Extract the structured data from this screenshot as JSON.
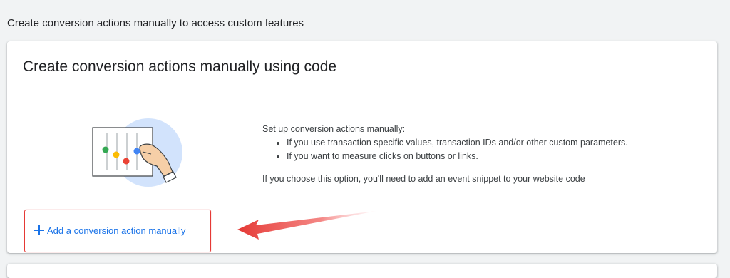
{
  "section": {
    "heading": "Create conversion actions manually to access custom features"
  },
  "card": {
    "title": "Create conversion actions manually using code",
    "illustration_icon": "manual-setup-sliders-illustration",
    "description": {
      "intro": "Set up conversion actions manually:",
      "bullets": [
        "If you use transaction specific values, transaction IDs and/or other custom parameters.",
        "If you want to measure clicks on buttons or links."
      ],
      "note": "If you choose this option, you'll need to add an event snippet to your website code"
    },
    "add_button": {
      "icon": "plus-icon",
      "label": "Add a conversion action manually"
    }
  },
  "annotation": {
    "highlight_color": "#e53935",
    "arrow_icon": "red-arrow-pointing-left"
  },
  "colors": {
    "accent": "#1a73e8",
    "background": "#f1f3f4",
    "card": "#ffffff"
  }
}
